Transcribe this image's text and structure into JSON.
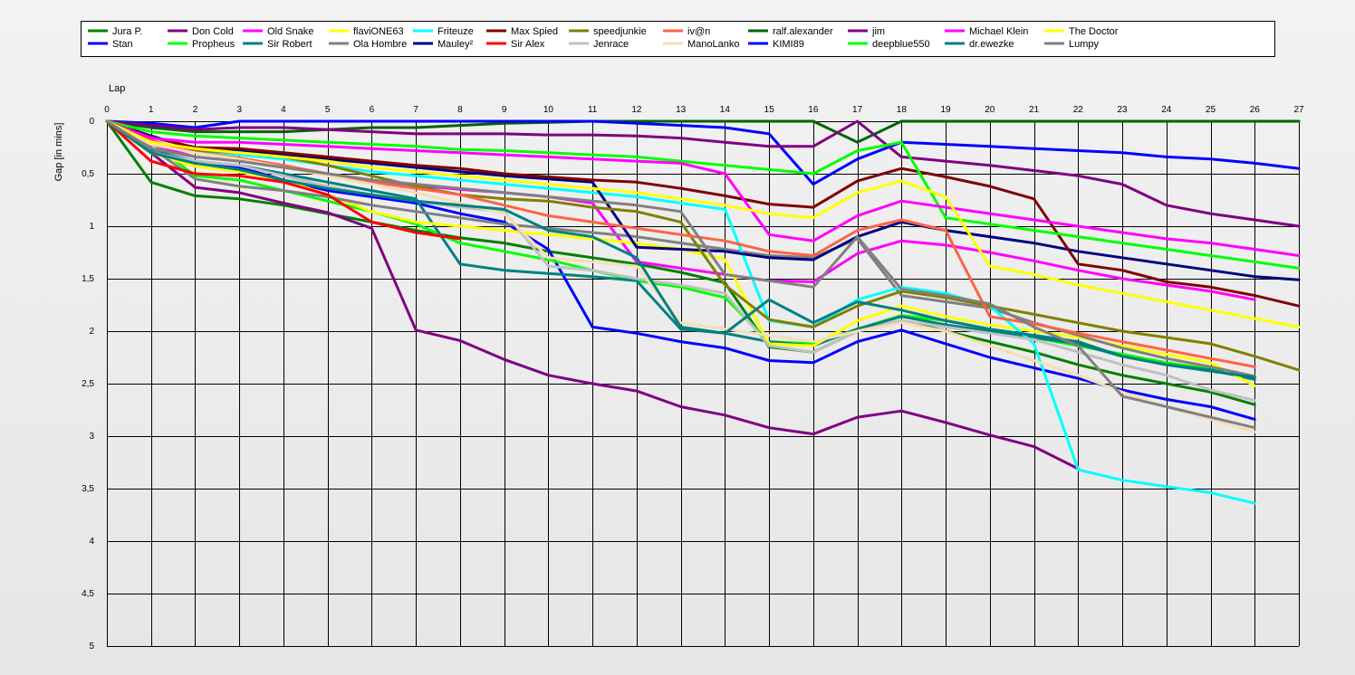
{
  "chart_data": {
    "type": "line",
    "title": "",
    "xlabel": "Lap",
    "ylabel": "Gap [in mins]",
    "xlim": [
      0,
      27
    ],
    "ylim": [
      0,
      5
    ],
    "y_inverted": true,
    "grid": true,
    "legend_position": "top",
    "x_ticks": [
      "0",
      "1",
      "2",
      "3",
      "4",
      "5",
      "6",
      "7",
      "8",
      "9",
      "10",
      "11",
      "12",
      "13",
      "14",
      "15",
      "16",
      "17",
      "18",
      "19",
      "20",
      "21",
      "22",
      "23",
      "24",
      "25",
      "26",
      "27"
    ],
    "y_ticks": [
      "0",
      "0,5",
      "1",
      "1,5",
      "2",
      "2,5",
      "3",
      "3,5",
      "4",
      "4,5",
      "5"
    ],
    "series": [
      {
        "name": "Jura P.",
        "color": "#008000",
        "values": [
          0,
          0.58,
          0.71,
          0.74,
          0.8,
          0.88,
          0.96,
          1.04,
          1.11,
          1.16,
          1.24,
          1.3,
          1.36,
          1.44,
          1.54,
          2.15,
          2.2,
          2.0,
          1.9,
          2.0,
          2.1,
          2.2,
          2.32,
          2.42,
          2.5,
          2.58,
          2.7
        ]
      },
      {
        "name": "Stan",
        "color": "#0000ff",
        "values": [
          0,
          0.3,
          0.4,
          0.44,
          0.56,
          0.66,
          0.72,
          0.78,
          0.88,
          0.96,
          1.22,
          1.96,
          2.02,
          2.1,
          2.16,
          2.28,
          2.3,
          2.1,
          1.99,
          2.12,
          2.25,
          2.35,
          2.45,
          2.56,
          2.65,
          2.72,
          2.84
        ]
      },
      {
        "name": "Don Cold",
        "color": "#800080",
        "values": [
          0,
          0.3,
          0.63,
          0.68,
          0.78,
          0.87,
          1.02,
          1.99,
          2.09,
          2.27,
          2.42,
          2.5,
          2.57,
          2.72,
          2.8,
          2.92,
          2.98,
          2.82,
          2.76,
          2.87,
          2.99,
          3.1,
          3.31
        ]
      },
      {
        "name": "Propheus",
        "color": "#00ff00",
        "values": [
          0,
          0.2,
          0.52,
          0.56,
          0.66,
          0.76,
          0.86,
          0.98,
          1.16,
          1.24,
          1.32,
          1.42,
          1.52,
          1.58,
          1.68,
          2.1,
          2.12,
          1.98,
          1.85,
          1.9,
          1.98,
          2.06,
          2.14,
          2.22,
          2.3,
          2.36,
          2.44
        ]
      },
      {
        "name": "Old Snake",
        "color": "#ff00ff",
        "values": [
          0,
          0.22,
          0.34,
          0.38,
          0.44,
          0.5,
          0.56,
          0.61,
          0.65,
          0.68,
          0.72,
          0.78,
          1.34,
          1.4,
          1.46,
          1.52,
          1.53,
          1.26,
          1.14,
          1.18,
          1.25,
          1.33,
          1.42,
          1.5,
          1.56,
          1.62,
          1.7
        ]
      },
      {
        "name": "Sir Robert",
        "color": "#008080",
        "values": [
          0,
          0.28,
          0.38,
          0.42,
          0.5,
          0.58,
          0.66,
          0.74,
          1.36,
          1.42,
          1.45,
          1.48,
          1.52,
          1.98,
          2.02,
          2.1,
          2.14,
          1.98,
          1.86,
          1.94,
          2.0,
          2.06,
          2.12,
          2.24,
          2.32,
          2.37,
          2.46
        ]
      },
      {
        "name": "flaviONE63",
        "color": "#ffff00",
        "values": [
          0,
          0.3,
          0.43,
          0.48,
          0.56,
          0.7,
          0.86,
          0.96,
          1.0,
          1.04,
          1.08,
          1.12,
          1.16,
          1.22,
          1.32,
          2.12,
          2.14,
          1.9,
          1.76,
          1.86,
          1.94,
          2.0,
          2.06,
          2.14,
          2.22,
          2.3,
          2.52
        ]
      },
      {
        "name": "Ola Hombre",
        "color": "#808080",
        "values": [
          0,
          0.25,
          0.55,
          0.62,
          0.66,
          0.72,
          0.8,
          0.86,
          0.92,
          0.98,
          1.02,
          1.06,
          1.1,
          1.16,
          1.22,
          1.28,
          1.3,
          1.12,
          1.66,
          1.72,
          1.78,
          1.92,
          2.04,
          2.16,
          2.26,
          2.34,
          2.43
        ]
      },
      {
        "name": "Friteuze",
        "color": "#00ffff",
        "values": [
          0,
          0.2,
          0.28,
          0.32,
          0.36,
          0.42,
          0.48,
          0.52,
          0.56,
          0.6,
          0.64,
          0.68,
          0.72,
          0.78,
          0.84,
          1.9,
          1.96,
          1.7,
          1.58,
          1.64,
          1.76,
          2.12,
          3.32,
          3.42,
          3.48,
          3.54,
          3.64
        ]
      },
      {
        "name": "Mauley²",
        "color": "#000080",
        "values": [
          0,
          0.14,
          0.26,
          0.28,
          0.32,
          0.36,
          0.4,
          0.44,
          0.48,
          0.52,
          0.55,
          0.58,
          1.2,
          1.22,
          1.24,
          1.3,
          1.32,
          1.1,
          0.96,
          1.04,
          1.1,
          1.16,
          1.24,
          1.3,
          1.36,
          1.42,
          1.48,
          1.51
        ]
      },
      {
        "name": "Max Spied",
        "color": "#800000",
        "values": [
          0,
          0.15,
          0.25,
          0.26,
          0.3,
          0.34,
          0.38,
          0.42,
          0.45,
          0.5,
          0.53,
          0.56,
          0.58,
          0.64,
          0.71,
          0.79,
          0.82,
          0.57,
          0.45,
          0.53,
          0.62,
          0.74,
          1.36,
          1.42,
          1.53,
          1.58,
          1.66,
          1.76
        ]
      },
      {
        "name": "Sir Alex",
        "color": "#ff0000",
        "values": [
          0,
          0.38,
          0.5,
          0.52,
          0.58,
          0.7,
          0.96,
          1.06,
          1.12
        ]
      },
      {
        "name": "speedjunkie",
        "color": "#808000",
        "values": [
          0,
          0.2,
          0.28,
          0.3,
          0.34,
          0.42,
          0.52,
          0.62,
          0.7,
          0.74,
          0.76,
          0.82,
          0.86,
          0.96,
          1.56,
          1.89,
          1.96,
          1.76,
          1.62,
          1.68,
          1.76,
          1.84,
          1.92,
          2.0,
          2.06,
          2.12,
          2.24,
          2.37
        ]
      },
      {
        "name": "Jenrace",
        "color": "#c0c0c0",
        "values": [
          0,
          0.3,
          0.38,
          0.42,
          0.52,
          0.62,
          0.7,
          0.76,
          0.82,
          0.86,
          1.38,
          1.42,
          1.5,
          1.56,
          1.64,
          2.14,
          2.2,
          2.0,
          1.9,
          1.96,
          2.02,
          2.08,
          2.2,
          2.32,
          2.42,
          2.56,
          2.66
        ]
      },
      {
        "name": "iv@n",
        "color": "#ff6347",
        "values": [
          0,
          0.18,
          0.3,
          0.35,
          0.42,
          0.5,
          0.58,
          0.64,
          0.7,
          0.8,
          0.9,
          0.96,
          1.02,
          1.08,
          1.14,
          1.24,
          1.28,
          1.04,
          0.94,
          1.04,
          1.86,
          1.93,
          2.02,
          2.1,
          2.18,
          2.26,
          2.34
        ]
      },
      {
        "name": "ManoLanko",
        "color": "#f5deb3",
        "values": [
          0,
          0.22,
          0.3,
          0.36,
          0.44,
          0.52,
          0.6,
          0.68,
          0.78,
          0.88,
          1.3,
          1.34,
          1.38,
          1.92,
          1.98,
          2.04,
          2.1,
          2.0,
          1.92,
          2.0,
          2.14,
          2.28,
          2.42,
          2.58,
          2.72,
          2.84,
          2.96
        ]
      },
      {
        "name": "ralf.alexander",
        "color": "#006400",
        "values": [
          0,
          0.06,
          0.1,
          0.1,
          0.1,
          0.08,
          0.06,
          0.06,
          0.04,
          0.02,
          0.01,
          0,
          0,
          0,
          0,
          0,
          0,
          0.2,
          0,
          0,
          0,
          0,
          0,
          0,
          0,
          0,
          0,
          0
        ]
      },
      {
        "name": "KIMI89",
        "color": "#0000ff",
        "values": [
          0,
          0.02,
          0.06,
          0,
          0,
          0,
          0,
          0,
          0,
          0,
          0,
          0,
          0.02,
          0.04,
          0.06,
          0.12,
          0.6,
          0.36,
          0.2,
          0.22,
          0.24,
          0.26,
          0.28,
          0.3,
          0.34,
          0.36,
          0.4,
          0.45
        ]
      },
      {
        "name": "jim",
        "color": "#800080",
        "values": [
          0,
          0.04,
          0.08,
          0.06,
          0.06,
          0.08,
          0.1,
          0.12,
          0.12,
          0.12,
          0.13,
          0.13,
          0.14,
          0.16,
          0.2,
          0.24,
          0.24,
          0,
          0.34,
          0.38,
          0.42,
          0.47,
          0.52,
          0.6,
          0.8,
          0.88,
          0.94,
          1.0
        ]
      },
      {
        "name": "deepblue550",
        "color": "#00ff00",
        "values": [
          0,
          0.1,
          0.14,
          0.16,
          0.18,
          0.2,
          0.22,
          0.24,
          0.27,
          0.28,
          0.3,
          0.32,
          0.34,
          0.38,
          0.42,
          0.46,
          0.5,
          0.28,
          0.2,
          0.92,
          0.98,
          1.04,
          1.1,
          1.16,
          1.22,
          1.28,
          1.34,
          1.4
        ]
      },
      {
        "name": "Michael Klein",
        "color": "#ff00ff",
        "values": [
          0,
          0.16,
          0.2,
          0.2,
          0.22,
          0.24,
          0.26,
          0.28,
          0.3,
          0.32,
          0.34,
          0.36,
          0.38,
          0.4,
          0.5,
          1.08,
          1.14,
          0.9,
          0.76,
          0.82,
          0.88,
          0.94,
          1.0,
          1.06,
          1.12,
          1.16,
          1.22,
          1.28
        ]
      },
      {
        "name": "dr.ewezke",
        "color": "#008080",
        "values": [
          0,
          0.3,
          0.4,
          0.46,
          0.56,
          0.64,
          0.7,
          0.76,
          0.8,
          0.84,
          1.04,
          1.1,
          1.3,
          1.96,
          2.02,
          1.7,
          1.92,
          1.72,
          1.8,
          1.9,
          1.98,
          2.04,
          2.1,
          2.24,
          2.32,
          2.38,
          2.44
        ]
      },
      {
        "name": "The Doctor",
        "color": "#ffff00",
        "values": [
          0,
          0.2,
          0.26,
          0.3,
          0.34,
          0.38,
          0.44,
          0.48,
          0.52,
          0.56,
          0.6,
          0.64,
          0.68,
          0.74,
          0.8,
          0.88,
          0.92,
          0.68,
          0.57,
          0.72,
          1.38,
          1.46,
          1.56,
          1.64,
          1.72,
          1.8,
          1.88,
          1.96
        ]
      },
      {
        "name": "Lumpy",
        "color": "#808080",
        "values": [
          0,
          0.26,
          0.34,
          0.38,
          0.44,
          0.5,
          0.56,
          0.6,
          0.64,
          0.68,
          0.72,
          0.76,
          0.8,
          0.86,
          1.46,
          1.52,
          1.58,
          1.1,
          1.6,
          1.66,
          1.74,
          1.96,
          2.14,
          2.62,
          2.72,
          2.82,
          2.92
        ]
      }
    ]
  }
}
